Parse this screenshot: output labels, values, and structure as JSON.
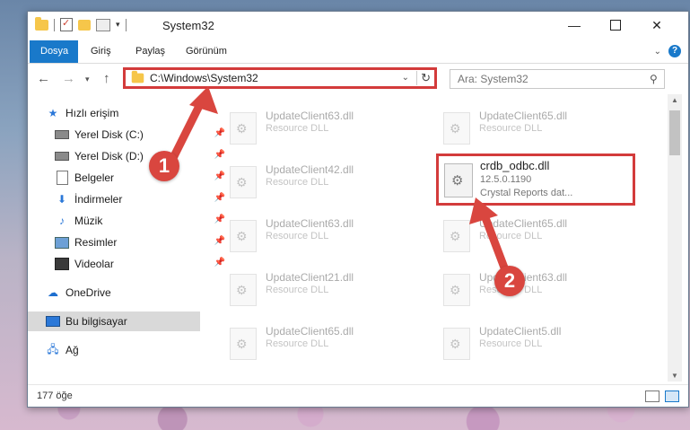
{
  "window": {
    "title": "System32",
    "minimize": "—",
    "close": "✕"
  },
  "ribbon": {
    "tabs": [
      "Dosya",
      "Giriş",
      "Paylaş",
      "Görünüm"
    ],
    "help": "?"
  },
  "address": {
    "path": "C:\\Windows\\System32",
    "search_placeholder": "Ara: System32"
  },
  "sidebar": {
    "items": [
      {
        "label": "Hızlı erişim",
        "icon": "star-icon"
      },
      {
        "label": "Yerel Disk (C:)",
        "icon": "disk-icon",
        "pinned": true
      },
      {
        "label": "Yerel Disk (D:)",
        "icon": "disk-icon",
        "pinned": true
      },
      {
        "label": "Belgeler",
        "icon": "document-icon",
        "pinned": true
      },
      {
        "label": "İndirmeler",
        "icon": "download-icon",
        "pinned": true
      },
      {
        "label": "Müzik",
        "icon": "music-icon",
        "pinned": true
      },
      {
        "label": "Resimler",
        "icon": "picture-icon",
        "pinned": true
      },
      {
        "label": "Videolar",
        "icon": "video-icon",
        "pinned": true
      },
      {
        "label": "OneDrive",
        "icon": "cloud-icon"
      },
      {
        "label": "Bu bilgisayar",
        "icon": "computer-icon",
        "selected": true
      },
      {
        "label": "Ağ",
        "icon": "network-icon"
      }
    ]
  },
  "files": [
    {
      "name": "UpdateClient63.dll",
      "desc": "Resource DLL"
    },
    {
      "name": "UpdateClient65.dll",
      "desc": "Resource DLL"
    },
    {
      "name": "UpdateClient42.dll",
      "desc": "Resource DLL"
    },
    {
      "name": "UpdateClient63.dll",
      "desc": "Resource DLL"
    },
    {
      "name": "UpdateClient65.dll",
      "desc": "Resource DLL"
    },
    {
      "name": "UpdateClient21.dll",
      "desc": "Resource DLL"
    },
    {
      "name": "UpdateClient63.dll",
      "desc": "Resource DLL"
    },
    {
      "name": "UpdateClient65.dll",
      "desc": "Resource DLL"
    },
    {
      "name": "UpdateClient5.dll",
      "desc": "Resource DLL"
    }
  ],
  "highlighted_file": {
    "name": "crdb_odbc.dll",
    "version": "12.5.0.1190",
    "desc": "Crystal Reports dat..."
  },
  "status": {
    "count": "177 öğe"
  },
  "annotations": {
    "step1": "1",
    "step2": "2",
    "color": "#d9463f"
  }
}
